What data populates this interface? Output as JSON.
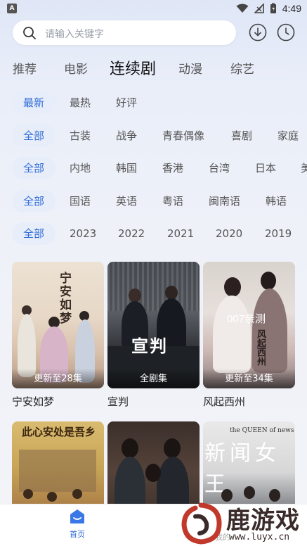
{
  "status_bar": {
    "left_glyph": "A",
    "time": "4:49",
    "icons": [
      "wifi-icon",
      "signal-icon",
      "battery-icon"
    ]
  },
  "search": {
    "placeholder": "请输入关键字",
    "icon": "search-icon"
  },
  "top_actions": [
    "download-icon",
    "history-icon"
  ],
  "tabs": [
    {
      "label": "推荐",
      "active": false
    },
    {
      "label": "电影",
      "active": false
    },
    {
      "label": "连续剧",
      "active": true
    },
    {
      "label": "动漫",
      "active": false
    },
    {
      "label": "综艺",
      "active": false
    }
  ],
  "filters": {
    "sort": [
      "最新",
      "最热",
      "好评"
    ],
    "genre": [
      "全部",
      "古装",
      "战争",
      "青春偶像",
      "喜剧",
      "家庭"
    ],
    "region": [
      "全部",
      "内地",
      "韩国",
      "香港",
      "台湾",
      "日本",
      "美"
    ],
    "language": [
      "全部",
      "国语",
      "英语",
      "粤语",
      "闽南语",
      "韩语"
    ],
    "year": [
      "全部",
      "2023",
      "2022",
      "2021",
      "2020",
      "2019"
    ]
  },
  "cards": [
    {
      "title": "宁安如梦",
      "badge": "更新至28集",
      "poster_text": "宁安如梦"
    },
    {
      "title": "宣判",
      "badge": "全剧集",
      "poster_text": "宣判"
    },
    {
      "title": "风起西州",
      "badge": "更新至34集",
      "poster_text": "风起西州",
      "overlay": "007亲测"
    },
    {
      "title": "",
      "badge": "",
      "poster_text": "此心安处是吾乡"
    },
    {
      "title": "",
      "badge": "",
      "poster_text": ""
    },
    {
      "title": "",
      "badge": "",
      "poster_text": "新闻女王",
      "subtitle": "the QUEEN of news"
    }
  ],
  "bottom_nav": {
    "home": "首页",
    "mine": "我的"
  },
  "watermark": {
    "text": "鹿游戏",
    "url": "www.luyx.cn"
  },
  "colors": {
    "accent": "#2f6bd6",
    "chip_bg": "#e8eef9"
  }
}
